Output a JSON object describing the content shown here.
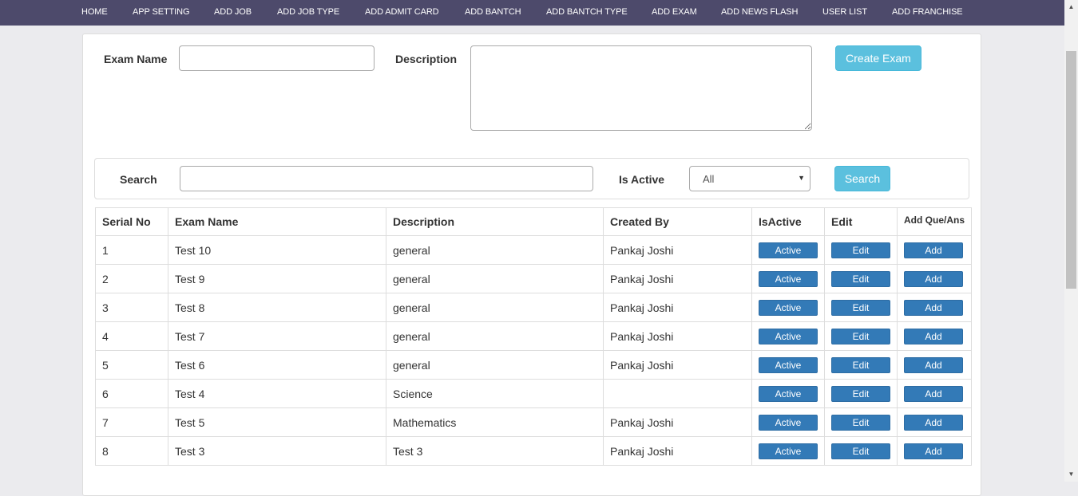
{
  "nav": {
    "items": [
      {
        "label": "HOME"
      },
      {
        "label": "APP SETTING"
      },
      {
        "label": "ADD JOB"
      },
      {
        "label": "ADD JOB TYPE"
      },
      {
        "label": "ADD ADMIT CARD"
      },
      {
        "label": "ADD BANTCH"
      },
      {
        "label": "ADD BANTCH TYPE"
      },
      {
        "label": "ADD EXAM"
      },
      {
        "label": "ADD NEWS FLASH"
      },
      {
        "label": "USER LIST"
      },
      {
        "label": "ADD FRANCHISE"
      }
    ]
  },
  "form": {
    "exam_name_label": "Exam Name",
    "exam_name_value": "",
    "description_label": "Description",
    "description_value": "",
    "create_button": "Create Exam"
  },
  "search": {
    "label": "Search",
    "value": "",
    "is_active_label": "Is Active",
    "is_active_selected": "All",
    "button": "Search"
  },
  "table": {
    "headers": [
      "Serial No",
      "Exam Name",
      "Description",
      "Created By",
      "IsActive",
      "Edit",
      "Add Que/Ans"
    ],
    "rows": [
      {
        "serial": "1",
        "name": "Test 10",
        "description": "general",
        "created_by": "Pankaj Joshi",
        "active": "Active",
        "edit": "Edit",
        "add": "Add"
      },
      {
        "serial": "2",
        "name": "Test 9",
        "description": "general",
        "created_by": "Pankaj Joshi",
        "active": "Active",
        "edit": "Edit",
        "add": "Add"
      },
      {
        "serial": "3",
        "name": "Test 8",
        "description": "general",
        "created_by": "Pankaj Joshi",
        "active": "Active",
        "edit": "Edit",
        "add": "Add"
      },
      {
        "serial": "4",
        "name": "Test 7",
        "description": "general",
        "created_by": "Pankaj Joshi",
        "active": "Active",
        "edit": "Edit",
        "add": "Add"
      },
      {
        "serial": "5",
        "name": "Test 6",
        "description": "general",
        "created_by": "Pankaj Joshi",
        "active": "Active",
        "edit": "Edit",
        "add": "Add"
      },
      {
        "serial": "6",
        "name": "Test 4",
        "description": "Science",
        "created_by": "",
        "active": "Active",
        "edit": "Edit",
        "add": "Add"
      },
      {
        "serial": "7",
        "name": "Test 5",
        "description": "Mathematics",
        "created_by": "Pankaj Joshi",
        "active": "Active",
        "edit": "Edit",
        "add": "Add"
      },
      {
        "serial": "8",
        "name": "Test 3",
        "description": "Test 3",
        "created_by": "Pankaj Joshi",
        "active": "Active",
        "edit": "Edit",
        "add": "Add"
      }
    ]
  },
  "colors": {
    "navbar": "#4d4a6b",
    "info_button": "#5bc0de",
    "primary_button": "#337ab7"
  }
}
